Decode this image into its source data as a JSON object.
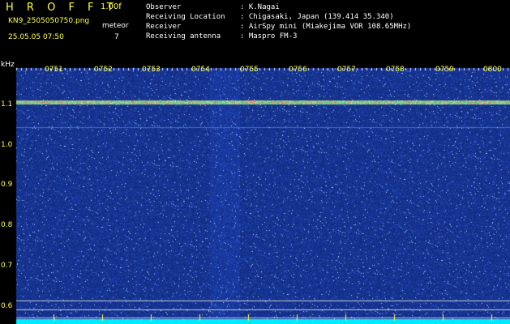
{
  "header": {
    "app_title": "H R O F F T",
    "version": "1.00f",
    "filename": "KN9_2505050750.png",
    "datetime": "25.05.05 07:50",
    "meteor_label": "meteor",
    "meteor_count": "7"
  },
  "info": [
    {
      "key": "Observer",
      "value": ": K.Nagai"
    },
    {
      "key": "Receiving Location",
      "value": ": Chigasaki, Japan (139.414 35.340)"
    },
    {
      "key": "Receiver",
      "value": ": AirSpy mini (Miakejima VOR 108.65MHz)"
    },
    {
      "key": "Receiving antenna",
      "value": ": Maspro FM-3"
    }
  ],
  "axis": {
    "y_unit": "kHz",
    "y_ticks": [
      "1.1",
      "1.0",
      "0.9",
      "0.8",
      "0.7",
      "0.6"
    ],
    "x_ticks": [
      "0751",
      "0752",
      "0753",
      "0754",
      "0755",
      "0756",
      "0757",
      "0758",
      "0759",
      "0800"
    ]
  },
  "colors": {
    "background": "#000000",
    "label_yellow": "#ffff40",
    "noise_blue": "#1a2fa0",
    "carrier": "#40e0e0",
    "baseline": "#00ffff"
  }
}
